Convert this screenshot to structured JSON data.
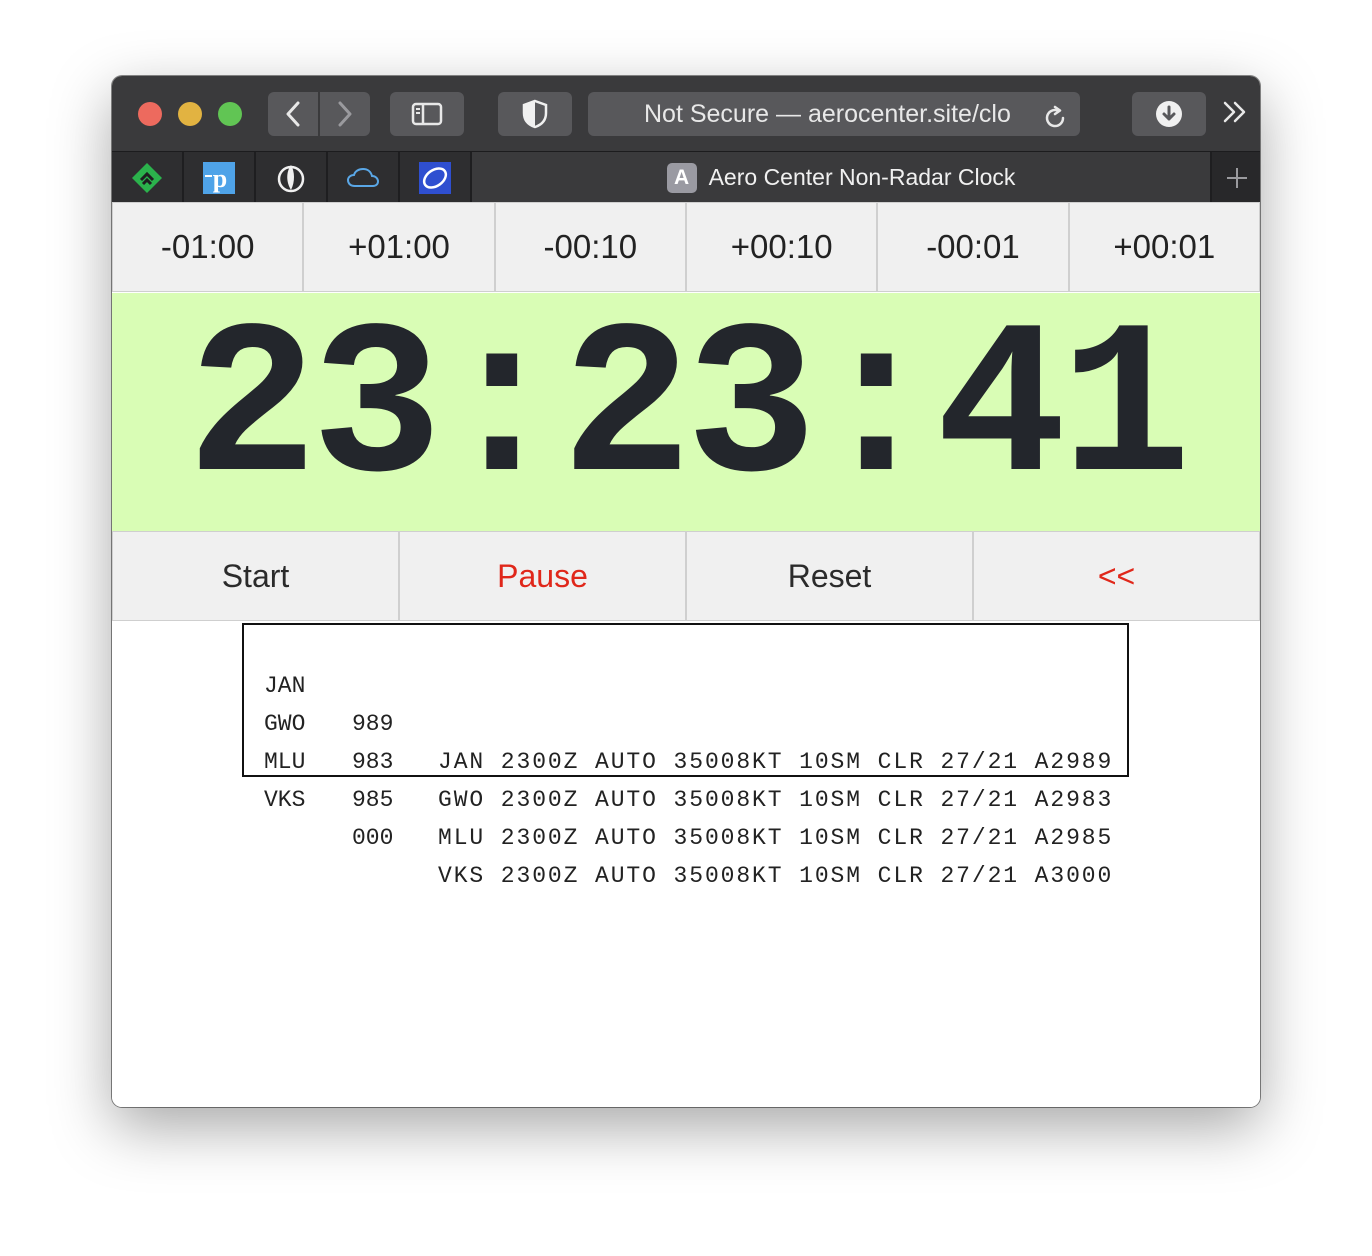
{
  "browser": {
    "url_text": "Not Secure — aerocenter.site/clo",
    "tab_title": "Aero Center Non-Radar Clock",
    "tab_favicon_letter": "A",
    "pinned_tabs": [
      "feedly-icon",
      "pinboard-icon",
      "kindle-icon",
      "cloud-icon",
      "dark-sky-icon"
    ]
  },
  "adjust_buttons": [
    "-01:00",
    "+01:00",
    "-00:10",
    "+00:10",
    "-00:01",
    "+00:01"
  ],
  "clock": {
    "time": "23:23:41",
    "background": "#d9fdb5"
  },
  "controls": {
    "start": "Start",
    "pause": "Pause",
    "reset": "Reset",
    "back": "<<"
  },
  "metar": [
    {
      "station": "JAN",
      "altimeter": "989",
      "report": "JAN 2300Z AUTO 35008KT 10SM CLR 27/21 A2989"
    },
    {
      "station": "GWO",
      "altimeter": "983",
      "report": "GWO 2300Z AUTO 35008KT 10SM CLR 27/21 A2983"
    },
    {
      "station": "MLU",
      "altimeter": "985",
      "report": "MLU 2300Z AUTO 35008KT 10SM CLR 27/21 A2985"
    },
    {
      "station": "VKS",
      "altimeter": "000",
      "report": "VKS 2300Z AUTO 35008KT 10SM CLR 27/21 A3000"
    }
  ],
  "colors": {
    "accent_red": "#e0271a"
  }
}
